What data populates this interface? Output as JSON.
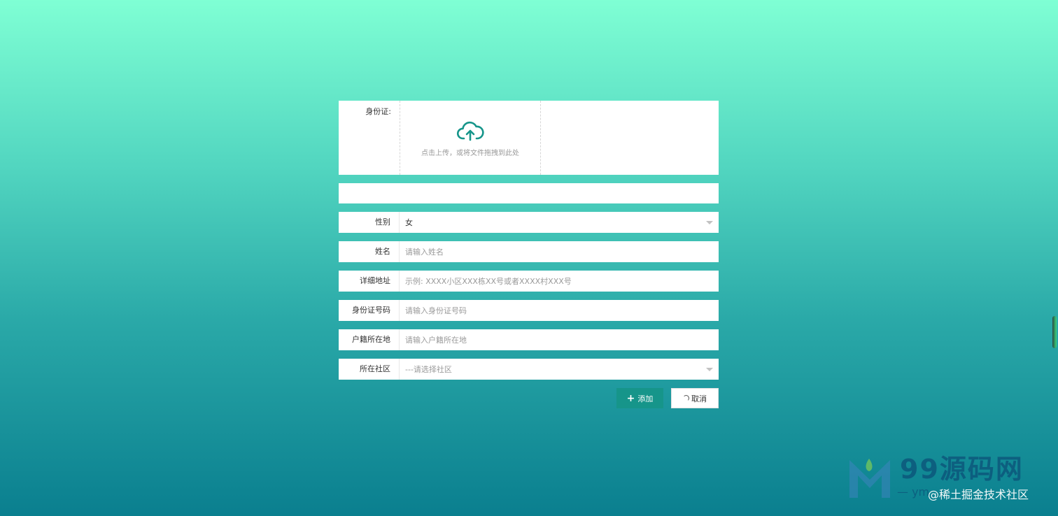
{
  "form": {
    "id_card_upload": {
      "label": "身份证:",
      "hint": "点击上传，或将文件拖拽到此处"
    },
    "gender": {
      "label": "性别",
      "value": "女"
    },
    "name": {
      "label": "姓名",
      "placeholder": "请输入姓名"
    },
    "address": {
      "label": "详细地址",
      "placeholder": "示例: XXXX小区XXX栋XX号或者XXXX村XXX号"
    },
    "id_number": {
      "label": "身份证号码",
      "placeholder": "请输入身份证号码"
    },
    "household": {
      "label": "户籍所在地",
      "placeholder": "请输入户籍所在地"
    },
    "community": {
      "label": "所在社区",
      "placeholder": "---请选择社区"
    }
  },
  "buttons": {
    "add_label": "添加",
    "cancel_label": "取消"
  },
  "watermark": {
    "title": "99源码网",
    "sub": "— ym",
    "credit": "@稀土掘金技术社区"
  },
  "colors": {
    "accent": "#16958a",
    "background_top": "#7fffd4",
    "background_bottom": "#0a7f8f"
  },
  "icons": {
    "upload": "cloud-upload-icon",
    "add": "plus-icon",
    "cancel": "loading-spinner-icon",
    "select": "chevron-down-icon"
  }
}
